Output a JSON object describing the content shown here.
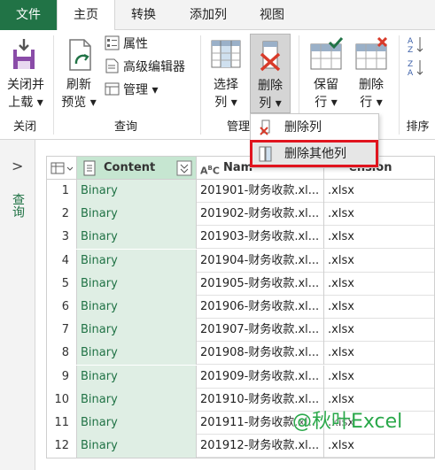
{
  "tabs": [
    {
      "label": "文件"
    },
    {
      "label": "主页"
    },
    {
      "label": "转换"
    },
    {
      "label": "添加列"
    },
    {
      "label": "视图"
    }
  ],
  "ribbon": {
    "close_load": {
      "line1": "关闭并",
      "line2": "上载 ▾"
    },
    "refresh": {
      "line1": "刷新",
      "line2": "预览 ▾"
    },
    "properties": "属性",
    "advanced_editor": "高级编辑器",
    "manage": "管理 ▾",
    "choose_cols": {
      "line1": "选择",
      "line2": "列 ▾"
    },
    "remove_cols": {
      "line1": "删除",
      "line2": "列 ▾"
    },
    "keep_rows": {
      "line1": "保留",
      "line2": "行 ▾"
    },
    "remove_rows": {
      "line1": "删除",
      "line2": "行 ▾"
    },
    "groups": {
      "close": "关闭",
      "query": "查询",
      "manage_cols": "管理",
      "sort": "排序"
    }
  },
  "menu": {
    "remove_columns": "删除列",
    "remove_other_columns": "删除其他列"
  },
  "left_pane": {
    "label": "查询"
  },
  "grid": {
    "headers": {
      "content": "Content",
      "name_prefix": "Nam",
      "ext_suffix": "ension"
    },
    "rows": [
      {
        "num": "1",
        "content": "Binary",
        "name": "201901-财务收款.xl...",
        "ext": ".xlsx"
      },
      {
        "num": "2",
        "content": "Binary",
        "name": "201902-财务收款.xl...",
        "ext": ".xlsx"
      },
      {
        "num": "3",
        "content": "Binary",
        "name": "201903-财务收款.xl...",
        "ext": ".xlsx"
      },
      {
        "num": "4",
        "content": "Binary",
        "name": "201904-财务收款.xl...",
        "ext": ".xlsx"
      },
      {
        "num": "5",
        "content": "Binary",
        "name": "201905-财务收款.xl...",
        "ext": ".xlsx"
      },
      {
        "num": "6",
        "content": "Binary",
        "name": "201906-财务收款.xl...",
        "ext": ".xlsx"
      },
      {
        "num": "7",
        "content": "Binary",
        "name": "201907-财务收款.xl...",
        "ext": ".xlsx"
      },
      {
        "num": "8",
        "content": "Binary",
        "name": "201908-财务收款.xl...",
        "ext": ".xlsx"
      },
      {
        "num": "9",
        "content": "Binary",
        "name": "201909-财务收款.xl...",
        "ext": ".xlsx"
      },
      {
        "num": "10",
        "content": "Binary",
        "name": "201910-财务收款.xl...",
        "ext": ".xlsx"
      },
      {
        "num": "11",
        "content": "Binary",
        "name": "201911-财务收款.xl...",
        "ext": ".xlsx"
      },
      {
        "num": "12",
        "content": "Binary",
        "name": "201912-财务收款.xl...",
        "ext": ".xlsx"
      }
    ]
  },
  "watermark": "@秋叶Excel",
  "colors": {
    "accent": "#217346",
    "highlight": "#e0141e",
    "content_col": "#dfeee4"
  }
}
